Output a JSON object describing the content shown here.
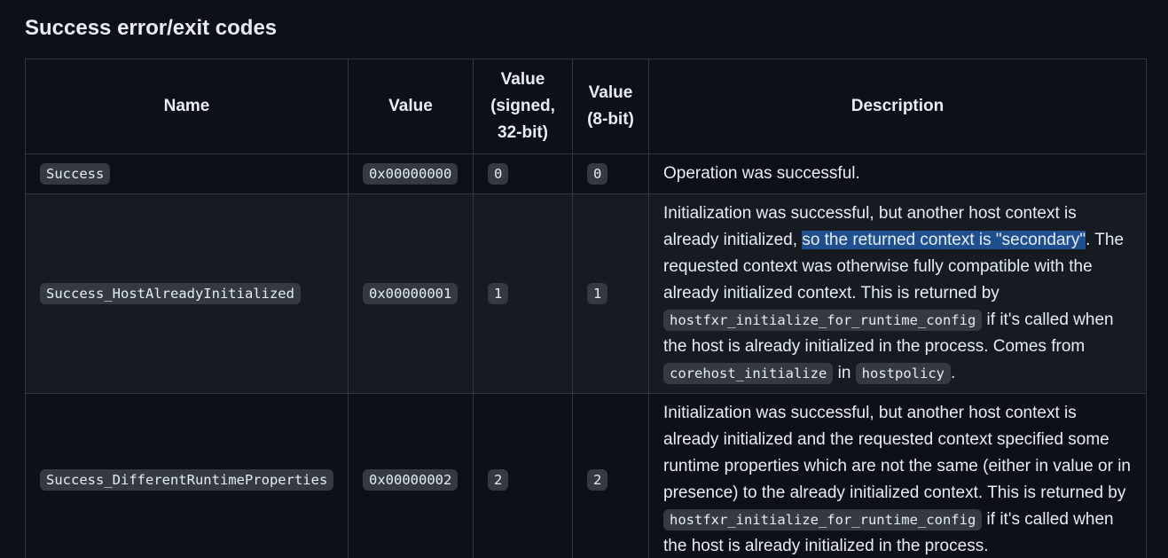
{
  "heading": "Success error/exit codes",
  "table": {
    "headers": {
      "name": "Name",
      "value": "Value",
      "signed": "Value (signed, 32-bit)",
      "bit8": "Value (8-bit)",
      "description": "Description"
    },
    "rows": [
      {
        "name": "Success",
        "value": "0x00000000",
        "signed": "0",
        "bit8": "0",
        "desc": {
          "text": "Operation was successful."
        }
      },
      {
        "name": "Success_HostAlreadyInitialized",
        "value": "0x00000001",
        "signed": "1",
        "bit8": "1",
        "desc": {
          "part1": "Initialization was successful, but another host context is already initialized, ",
          "highlighted": "so the returned context is \"secondary\"",
          "part2": ". The requested context was otherwise fully compatible with the already initialized context. This is returned by ",
          "code1": "hostfxr_initialize_for_runtime_config",
          "part3": " if it's called when the host is already initialized in the process. Comes from ",
          "code2": "corehost_initialize",
          "part4": " in ",
          "code3": "hostpolicy",
          "part5": "."
        }
      },
      {
        "name": "Success_DifferentRuntimeProperties",
        "value": "0x00000002",
        "signed": "2",
        "bit8": "2",
        "desc": {
          "part1": "Initialization was successful, but another host context is already initialized and the requested context specified some runtime properties which are not the same (either in value or in presence) to the already initialized context. This is returned by ",
          "code1": "hostfxr_initialize_for_runtime_config",
          "part2": " if it's called when the host is already initialized in the process."
        }
      }
    ]
  },
  "colors": {
    "background": "#0d1117",
    "alt_row": "#161b22",
    "border": "#30363d",
    "code_bg": "#343942",
    "selection": "#1f4f8f"
  }
}
